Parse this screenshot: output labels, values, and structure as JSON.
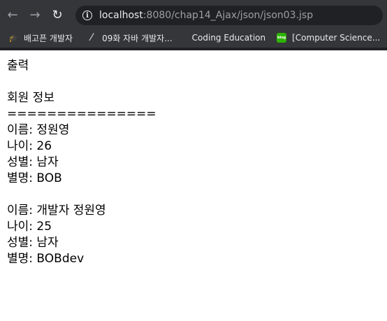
{
  "browser": {
    "url_host": "localhost",
    "url_rest": ":8080/chap14_Ajax/json/json03.jsp",
    "bookmarks": [
      {
        "label": "배고픈 개발자",
        "icon": "graduation-cap-icon"
      },
      {
        "label": "09화 자바 개발자...",
        "icon": "slash-icon"
      },
      {
        "label": "Coding Education",
        "icon": ""
      },
      {
        "label": "[Computer Science...",
        "icon": "blog-icon",
        "icon_text": "blog"
      }
    ]
  },
  "page": {
    "heading": "출력",
    "section_title": "회원 정보",
    "divider": "===============",
    "members": [
      {
        "name": "이름: 정원영",
        "age": "나이: 26",
        "gender": "성별: 남자",
        "nickname": "별명: BOB"
      },
      {
        "name": "이름: 개발자 정원영",
        "age": "나이: 25",
        "gender": "성별: 남자",
        "nickname": "별명: BOBdev"
      }
    ]
  }
}
